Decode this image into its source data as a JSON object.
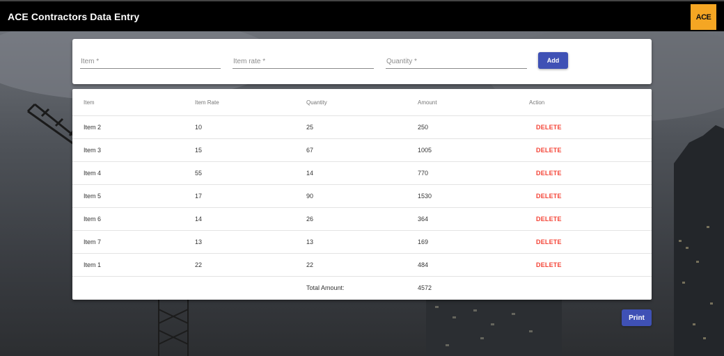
{
  "app": {
    "title": "ACE Contractors Data Entry",
    "logo_text": "ACE",
    "logo_color": "#f5a623"
  },
  "form": {
    "item_placeholder": "Item *",
    "rate_placeholder": "Item rate *",
    "quantity_placeholder": "Quantity *",
    "item_value": "",
    "rate_value": "",
    "quantity_value": "",
    "add_label": "Add"
  },
  "table": {
    "headers": [
      "Item",
      "Item Rate",
      "Quantity",
      "Amount",
      "Action"
    ],
    "rows": [
      {
        "item": "Item 2",
        "rate": "10",
        "quantity": "25",
        "amount": "250",
        "action": "DELETE"
      },
      {
        "item": "Item 3",
        "rate": "15",
        "quantity": "67",
        "amount": "1005",
        "action": "DELETE"
      },
      {
        "item": "Item 4",
        "rate": "55",
        "quantity": "14",
        "amount": "770",
        "action": "DELETE"
      },
      {
        "item": "Item 5",
        "rate": "17",
        "quantity": "90",
        "amount": "1530",
        "action": "DELETE"
      },
      {
        "item": "Item 6",
        "rate": "14",
        "quantity": "26",
        "amount": "364",
        "action": "DELETE"
      },
      {
        "item": "Item 7",
        "rate": "13",
        "quantity": "13",
        "amount": "169",
        "action": "DELETE"
      },
      {
        "item": "Item 1",
        "rate": "22",
        "quantity": "22",
        "amount": "484",
        "action": "DELETE"
      }
    ],
    "total_label": "Total Amount:",
    "total_value": "4572"
  },
  "print_label": "Print",
  "colors": {
    "primary": "#3f51b5",
    "delete": "#f44336",
    "topbar": "#000000"
  }
}
